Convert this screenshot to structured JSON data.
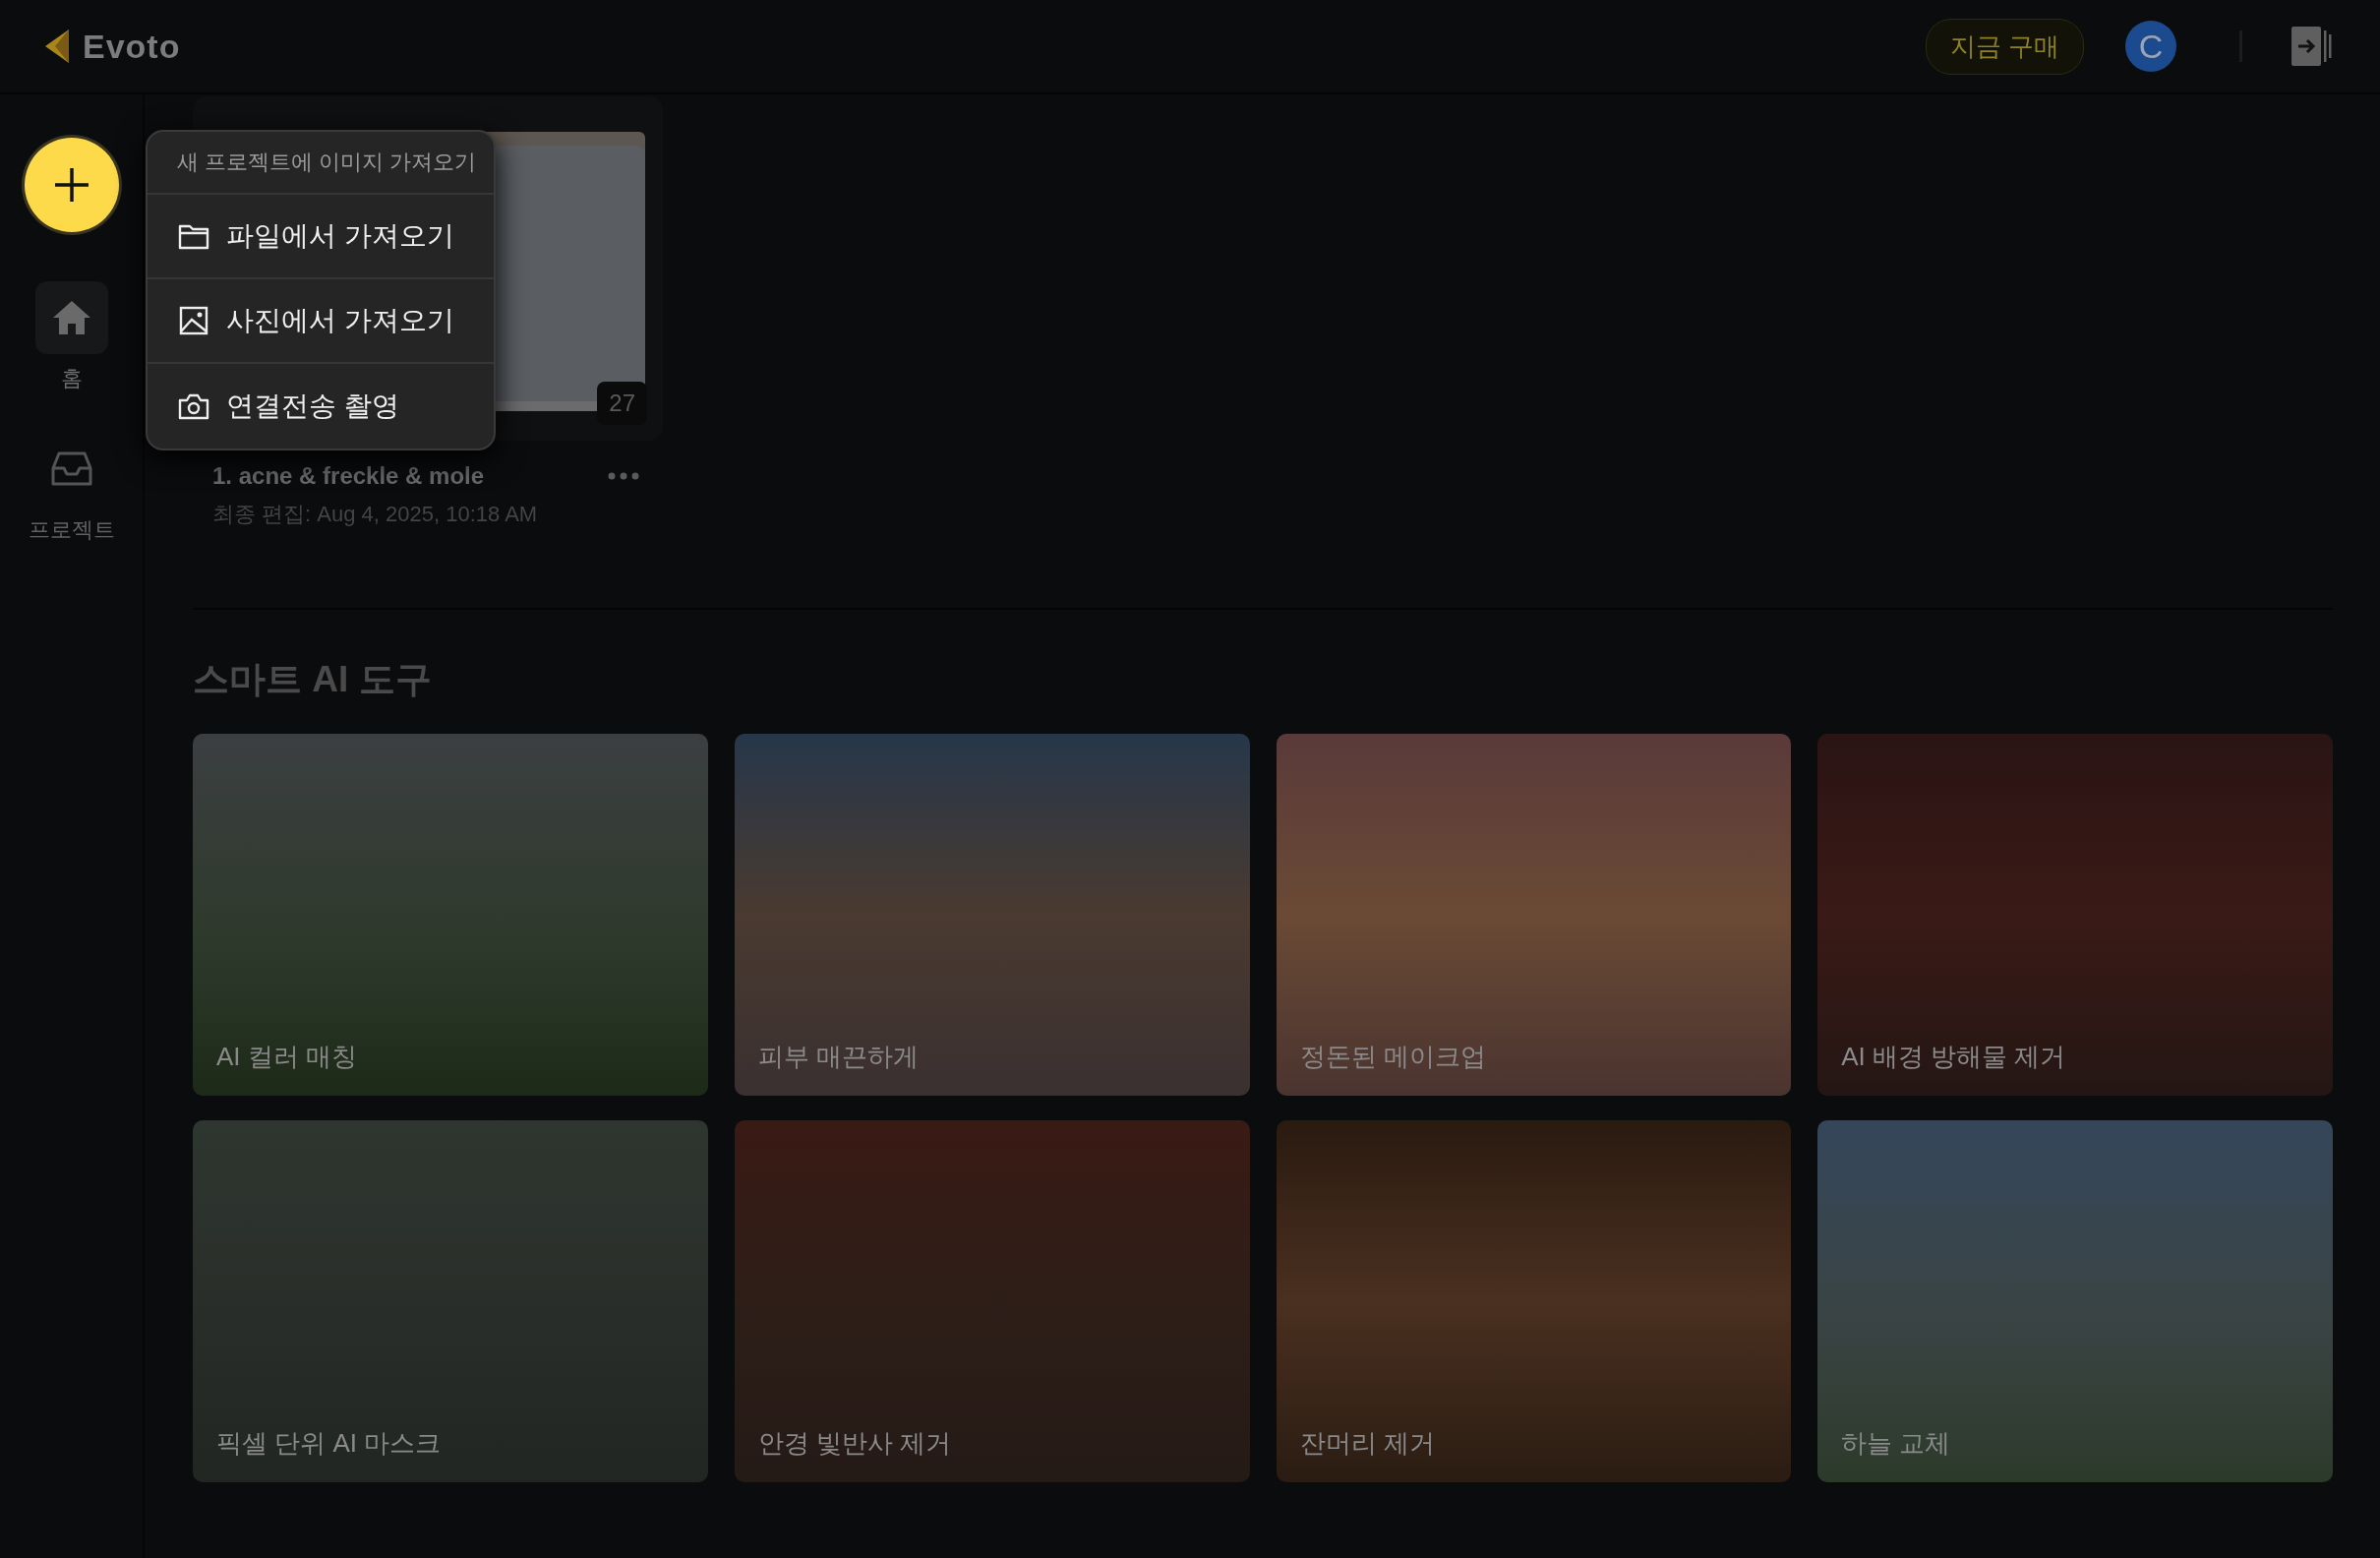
{
  "header": {
    "logo": "Evoto",
    "buy_button": "지금 구매",
    "avatar": "C"
  },
  "new_button": {
    "expanded": true
  },
  "sidebar": {
    "items": [
      {
        "label": "홈",
        "kind": "home",
        "selected": true
      },
      {
        "label": "프로젝트",
        "kind": "projects",
        "selected": false
      }
    ]
  },
  "import_menu": {
    "title": "새 프로젝트에 이미지 가져오기",
    "items": [
      {
        "label": "파일에서 가져오기",
        "kind": "folder"
      },
      {
        "label": "사진에서 가져오기",
        "kind": "image"
      },
      {
        "label": "연결전송 촬영",
        "kind": "camera"
      }
    ]
  },
  "projects": [
    {
      "title": "1. acne & freckle & mole",
      "edited": "최종 편집: Aug 4, 2025, 10:18 AM",
      "count": "27"
    }
  ],
  "smart_tools": {
    "title": "스마트 AI 도구",
    "cards": [
      {
        "label": "AI 컬러 매칭"
      },
      {
        "label": "피부 매끈하게"
      },
      {
        "label": "정돈된 메이크업"
      },
      {
        "label": "AI 배경 방해물 제거"
      },
      {
        "label": "픽셀 단위 AI 마스크"
      },
      {
        "label": "안경 빛반사 제거"
      },
      {
        "label": "잔머리 제거"
      },
      {
        "label": "하늘 교체"
      }
    ]
  }
}
